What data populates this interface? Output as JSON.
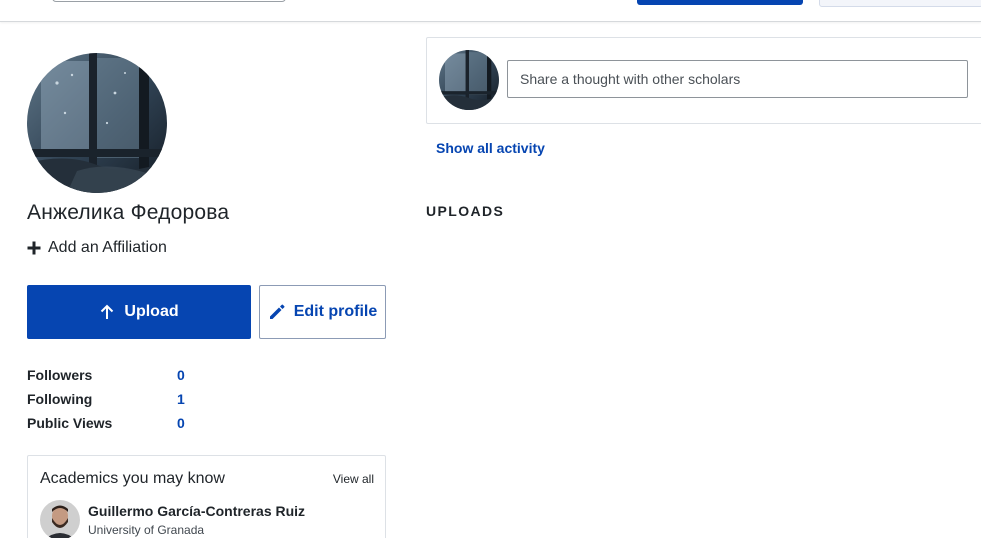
{
  "profile": {
    "name": "Анжелика Федорова",
    "affiliation_action": "Add an Affiliation",
    "upload_label": "Upload",
    "edit_label": "Edit profile"
  },
  "stats": [
    {
      "label": "Followers",
      "value": "0"
    },
    {
      "label": "Following",
      "value": "1"
    },
    {
      "label": "Public Views",
      "value": "0"
    }
  ],
  "academics": {
    "title": "Academics you may know",
    "view_all": "View all",
    "people": [
      {
        "name": "Guillermo García-Contreras Ruiz",
        "institution": "University of Granada"
      }
    ]
  },
  "activity": {
    "share_placeholder": "Share a thought with other scholars",
    "show_all": "Show all activity",
    "uploads_heading": "UPLOADS"
  },
  "icons": {
    "plus": "plus-icon",
    "upload": "arrow-up-icon",
    "edit": "pencil-icon"
  },
  "colors": {
    "brand_blue": "#0645b1",
    "text": "#1f2429",
    "border": "#dde1e6"
  }
}
